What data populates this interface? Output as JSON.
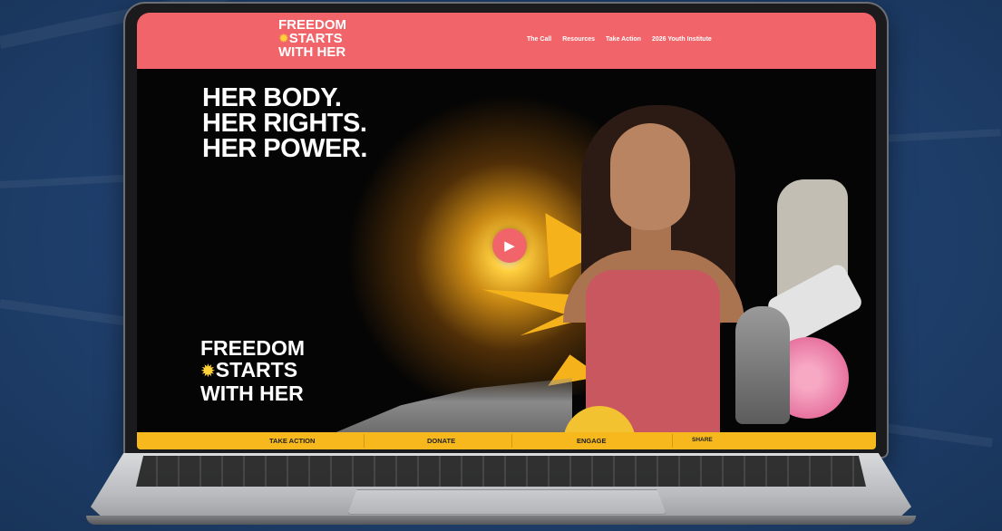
{
  "site": {
    "logo": {
      "line1": "FREEDOM",
      "line2": "STARTS",
      "line3": "WITH HER",
      "sun_icon": "starburst-icon"
    },
    "nav": [
      "The Call",
      "Resources",
      "Take Action",
      "2026 Youth Institute"
    ]
  },
  "hero": {
    "headline": [
      "HER BODY.",
      "HER RIGHTS.",
      "HER POWER."
    ],
    "logo": {
      "line1": "FREEDOM",
      "line2": "STARTS",
      "line3": "WITH HER"
    },
    "play_icon": "play-icon",
    "play_glyph": "▶"
  },
  "footer_bar": [
    "TAKE ACTION",
    "DONATE",
    "ENGAGE",
    "SHARE"
  ],
  "colors": {
    "header": "#f0646a",
    "footer": "#f6b81d",
    "background": "#1f3f6c"
  }
}
